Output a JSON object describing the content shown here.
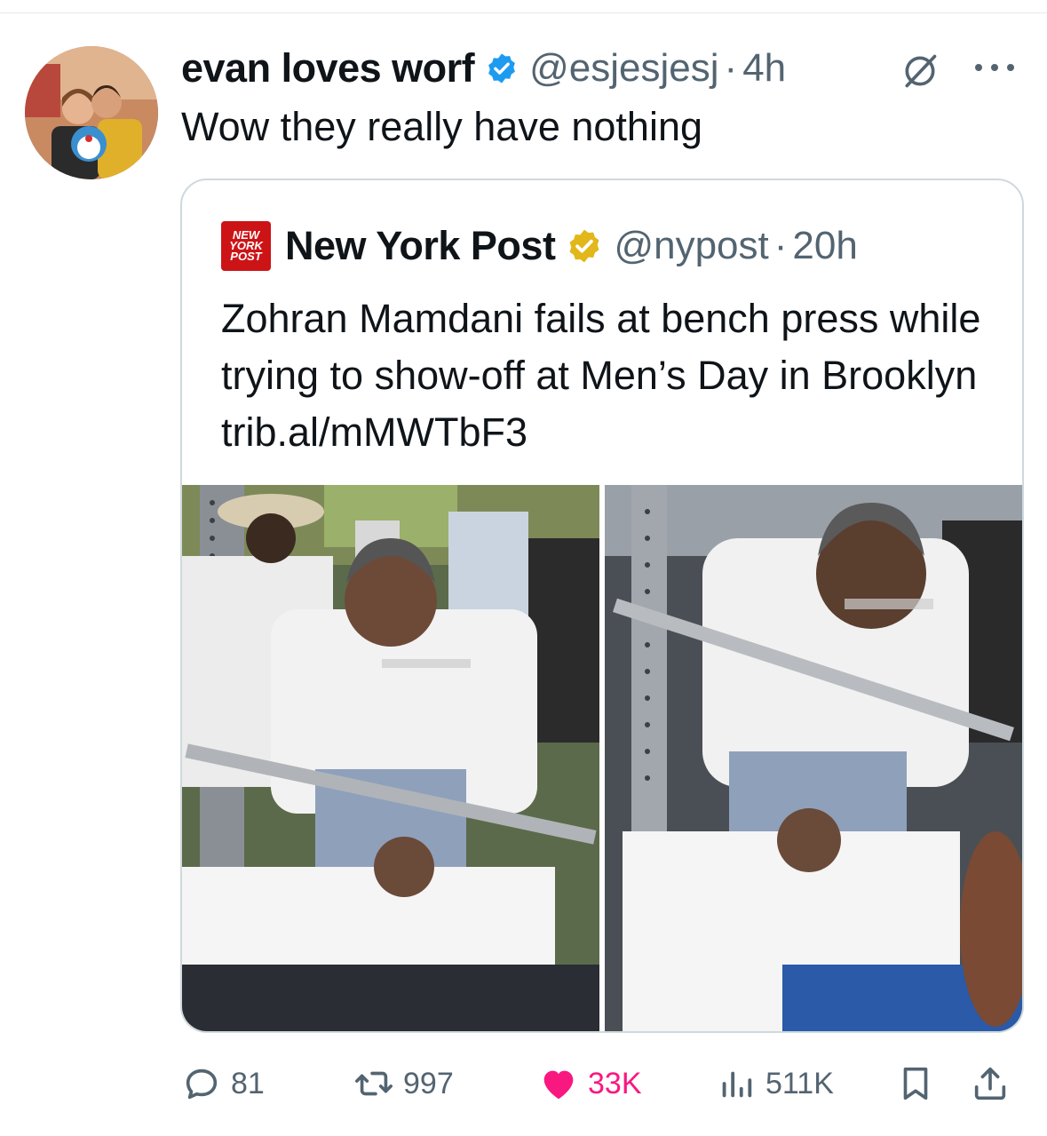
{
  "tweet": {
    "display_name": "evan loves worf",
    "handle": "@esjesjesj",
    "time": "4h",
    "text": "Wow they really have nothing",
    "verified_color": "#1d9bf0"
  },
  "quoted_tweet": {
    "display_name": "New York Post",
    "handle": "@nypost",
    "time": "20h",
    "logo_lines": [
      "NEW",
      "YORK",
      "POST"
    ],
    "text": "Zohran Mamdani fails at bench press while trying to show-off at Men’s Day in Brooklyn trib.al/mMWTbF3",
    "verified_color": "#e2b719",
    "logo_color": "#cc1417"
  },
  "icons": {
    "verified": "verified-badge-icon",
    "grok": "grok-icon",
    "more": "more-options-icon",
    "reply": "reply-icon",
    "retweet": "retweet-icon",
    "like": "heart-icon",
    "views": "views-chart-icon",
    "bookmark": "bookmark-icon",
    "share": "share-icon"
  },
  "actions": {
    "replies": "81",
    "retweets": "997",
    "likes": "33K",
    "views": "511K"
  },
  "colors": {
    "text": "#0f1419",
    "secondary": "#536471",
    "like": "#f91880",
    "border": "#cfd9de"
  },
  "separator": "·"
}
